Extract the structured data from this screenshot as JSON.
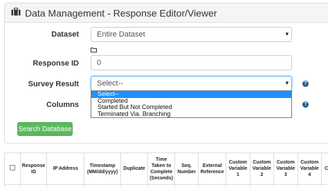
{
  "header": {
    "title": "Data Management - Response Editor/Viewer",
    "icon": "briefcase-icon"
  },
  "form": {
    "dataset": {
      "label": "Dataset",
      "value": "Entire Dataset"
    },
    "response_id": {
      "label": "Response ID",
      "value": "0"
    },
    "survey_result": {
      "label": "Survey Result",
      "value": "Select--",
      "options": [
        "Select--",
        "Completed",
        "Started But Not Completed",
        "Terminated Via. Branching"
      ],
      "selected_index": 0
    },
    "columns": {
      "label": "Columns"
    },
    "help_glyph": "?"
  },
  "search_button": "Search Database",
  "table": {
    "headers": [
      "",
      "Response ID",
      "IP Address",
      "Timestamp (MM/dd/yyyy)",
      "Duplicate",
      "Time Taken to Complete (Seconds)",
      "Seq. Number",
      "External Reference",
      "Custom Variable 1",
      "Custom Variable 2",
      "Custom Variable 3",
      "Custom Variable 4",
      "C V"
    ]
  },
  "colors": {
    "accent": "#5cb85c",
    "help": "#1f5d8c",
    "highlight": "#1e90ff"
  }
}
